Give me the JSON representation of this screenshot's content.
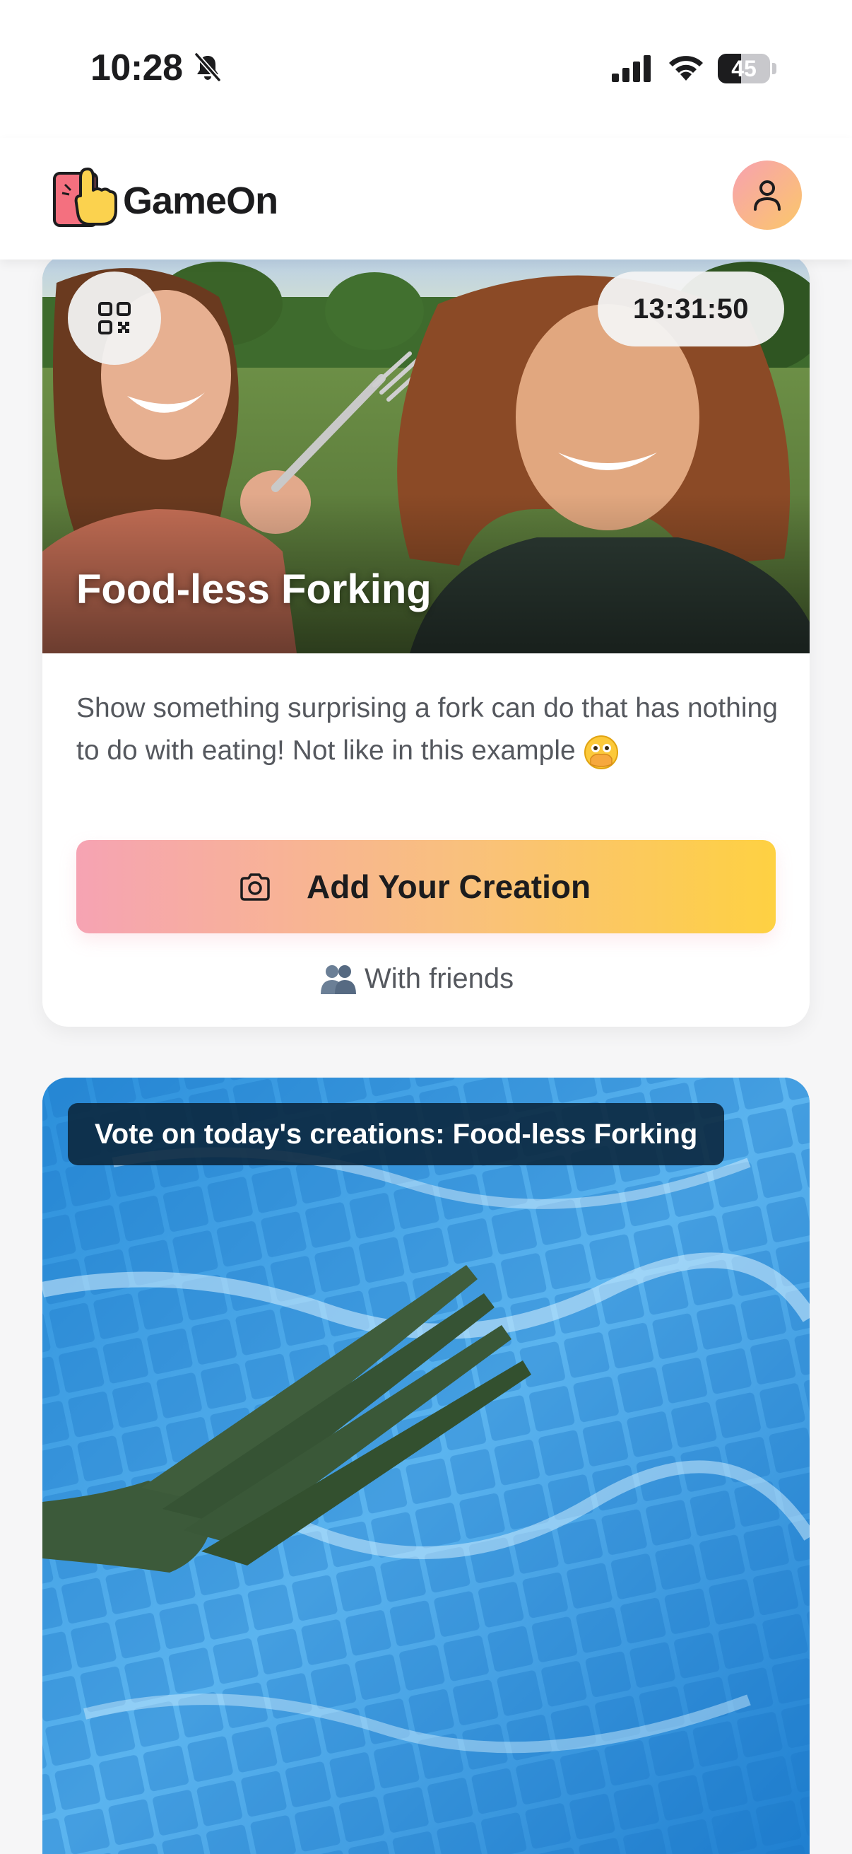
{
  "status_bar": {
    "time": "10:28",
    "battery": "45",
    "battery_level": 0.45,
    "icons": [
      "bell-slash-icon",
      "cellular-signal-icon",
      "wifi-icon",
      "battery-icon"
    ]
  },
  "header": {
    "brand": "GameOn",
    "logo_icon": "pointing-hand-logo-icon",
    "profile_icon": "person-icon"
  },
  "challenge": {
    "title": "Food-less Forking",
    "timer": "13:31:50",
    "description": "Show something surprising a fork can do that has nothing to do with eating! Not like in this example",
    "description_emoji": "face-with-open-eyes-and-hand-over-mouth",
    "cta_label": "Add Your Creation",
    "cta_icon": "camera-icon",
    "friends_label": "With friends",
    "friends_icon": "busts-in-silhouette-icon",
    "qr_icon": "qr-code-icon"
  },
  "vote": {
    "banner": "Vote on today's creations: Food-less Forking"
  },
  "colors": {
    "gradient_start": "#f6a3b3",
    "gradient_end": "#fed142",
    "text_muted": "#55585e",
    "vote_banner_bg": "#0a243a"
  }
}
